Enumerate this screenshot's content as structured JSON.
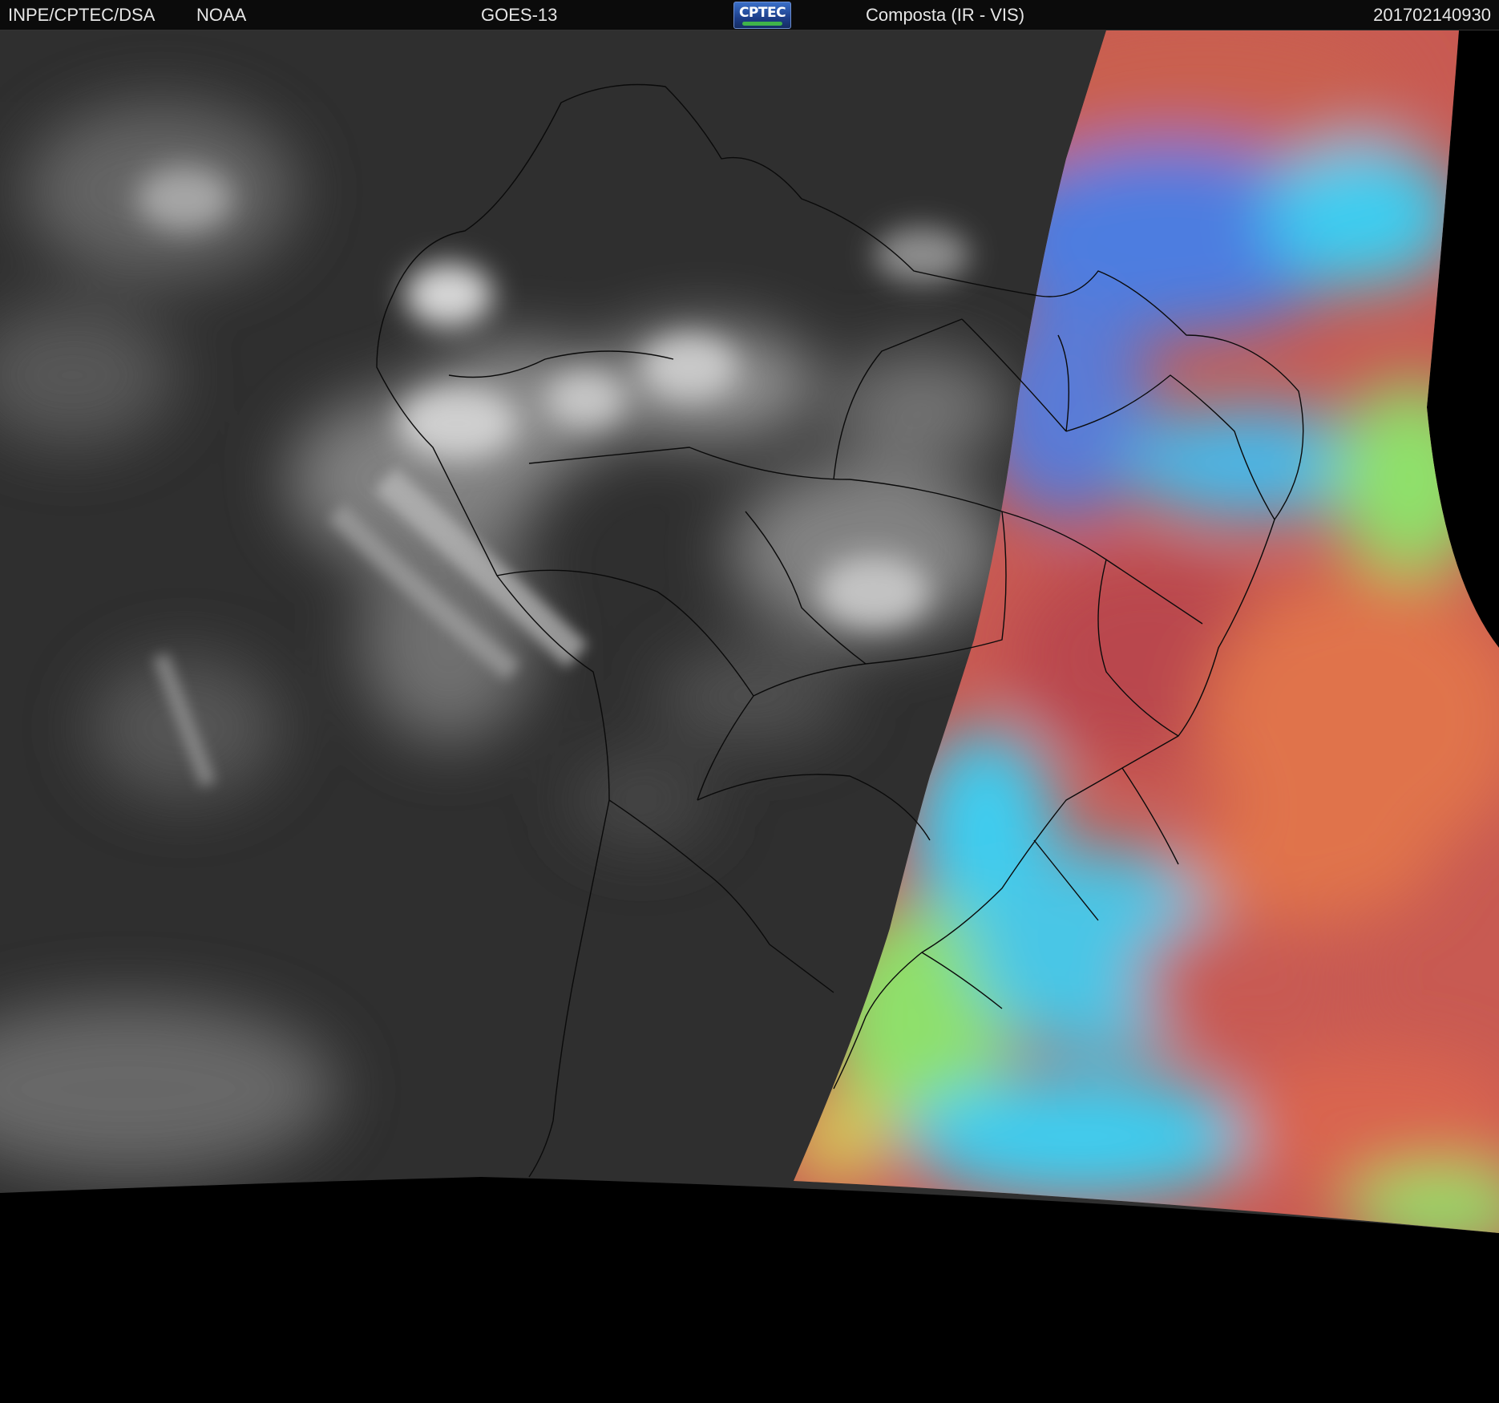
{
  "header": {
    "agency": "INPE/CPTEC/DSA",
    "source": "NOAA",
    "satellite": "GOES-13",
    "logo_text": "CPTEC",
    "product": "Composta (IR - VIS)",
    "timestamp": "201702140930"
  },
  "colors": {
    "header_bg": "#0b0b0b",
    "header_text": "#e6e6e6",
    "ir_dark": "#2f2f2f",
    "ir_cloud": "#d9d9d9",
    "vis_red": "#c85a52",
    "vis_orange": "#e0734c",
    "vis_blue": "#4d7de0",
    "vis_cyan": "#3ccdf0",
    "vis_green": "#8fe06a",
    "space": "#000000",
    "borders": "#0a0a0a"
  },
  "icons": {
    "logo": "cptec-logo"
  }
}
